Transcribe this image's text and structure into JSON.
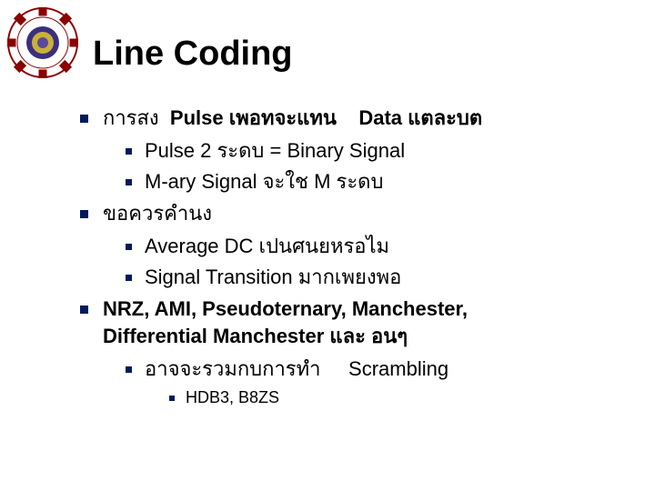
{
  "title": "Line Coding",
  "bullets": {
    "b1_pre": "การสง ",
    "b1_mid": "Pulse เพอทจะแทน",
    "b1_spacer": "    ",
    "b1_end": "Data แตละบต",
    "b1_1": "Pulse 2 ระดบ  = Binary Signal",
    "b1_2": "M-ary Signal จะใช  M ระดบ",
    "b2": "ขอควรคำนง",
    "b2_1": "Average DC เปนศนยหรอไม",
    "b2_2": "Signal Transition มากเพยงพอ",
    "b3_line1": "NRZ, AMI, Pseudoternary, Manchester,",
    "b3_line2": "Differential Manchester และ อนๆ",
    "b3_1_pre": "อาจจะรวมกบการทำ",
    "b3_1_spacer": "     ",
    "b3_1_end": "Scrambling",
    "b3_1_1": "HDB3, B8ZS"
  }
}
